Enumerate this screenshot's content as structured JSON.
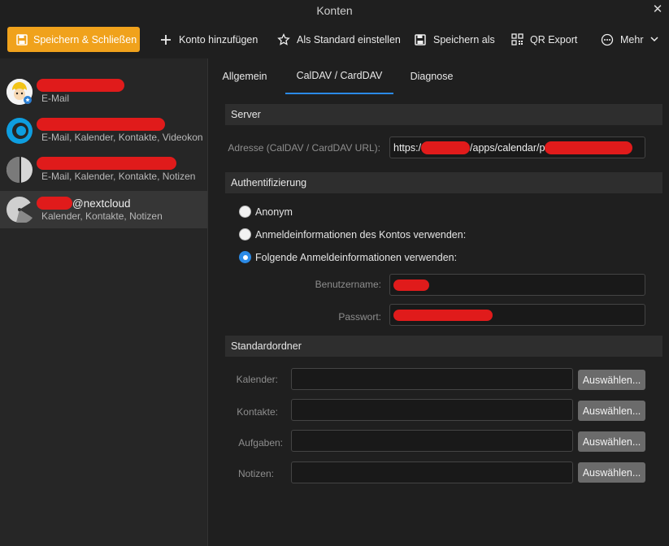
{
  "window": {
    "title": "Konten",
    "close_glyph": "✕"
  },
  "toolbar": {
    "save_close": "Speichern & Schließen",
    "add_account": "Konto hinzufügen",
    "set_default": "Als Standard einstellen",
    "save_as": "Speichern als",
    "qr_export": "QR Export",
    "more": "Mehr"
  },
  "accounts": [
    {
      "name_suffix": "",
      "services": "E-Mail"
    },
    {
      "name_suffix": "",
      "services": "E-Mail, Kalender, Kontakte, Videokonferenzen"
    },
    {
      "name_suffix": "",
      "services": "E-Mail, Kalender, Kontakte, Notizen"
    },
    {
      "name_suffix": "@nextcloud",
      "services": "Kalender, Kontakte, Notizen"
    }
  ],
  "tabs": [
    "Allgemein",
    "CalDAV / CardDAV",
    "Diagnose"
  ],
  "server": {
    "heading": "Server",
    "address_label": "Adresse (CalDAV / CardDAV URL):",
    "url_prefix": "https:/",
    "url_middle": "/apps/calendar/p"
  },
  "auth": {
    "heading": "Authentifizierung",
    "options": [
      "Anonym",
      "Anmeldeinformationen des Kontos verwenden:",
      "Folgende Anmeldeinformationen verwenden:"
    ],
    "selected": 2,
    "username_label": "Benutzername:",
    "password_label": "Passwort:"
  },
  "folders": {
    "heading": "Standardordner",
    "rows": [
      "Kalender:",
      "Kontakte:",
      "Aufgaben:",
      "Notizen:"
    ],
    "choose_label": "Auswählen..."
  },
  "colors": {
    "accent": "#f0a21c",
    "tab_underline": "#2b8ae6",
    "redaction": "#e01b1b"
  }
}
